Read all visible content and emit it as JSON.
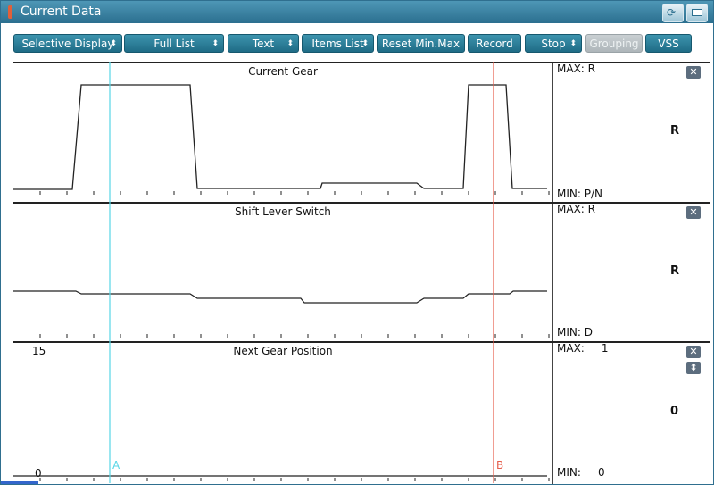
{
  "window": {
    "title": "Current Data"
  },
  "toolbar": {
    "buttons": [
      {
        "label": "Selective Display",
        "caret": "⬍"
      },
      {
        "label": "Full List",
        "caret": "⬍"
      },
      {
        "label": "Text",
        "caret": "⬍"
      },
      {
        "label": "Items List",
        "caret": "⬍"
      },
      {
        "label": "Reset Min.Max"
      },
      {
        "label": "Record"
      },
      {
        "label": "Stop",
        "caret": "⬍"
      },
      {
        "label": "Grouping",
        "disabled": true
      },
      {
        "label": "VSS"
      }
    ]
  },
  "panels": [
    {
      "name": "Current Gear",
      "max": "MAX: R",
      "min": "MIN: P/N",
      "current": "R"
    },
    {
      "name": "Shift Lever Switch",
      "max": "MAX: R",
      "min": "MIN: D",
      "current": "R"
    },
    {
      "name": "Next Gear Position",
      "max": "MAX:     1",
      "min": "MIN:     0",
      "current": "0",
      "scale_top": "15",
      "scale_bottom": "0"
    }
  ],
  "cursors": {
    "a_label": "A",
    "b_label": "B",
    "a_color": "#56d6e6",
    "b_color": "#e65c4a"
  },
  "icons": {
    "close": "close-icon",
    "expand": "expand-icon",
    "refresh": "refresh-icon",
    "minimize": "minimize-icon"
  },
  "colors": {
    "accent": "#2b6f8f",
    "button": "#1f6c86"
  }
}
